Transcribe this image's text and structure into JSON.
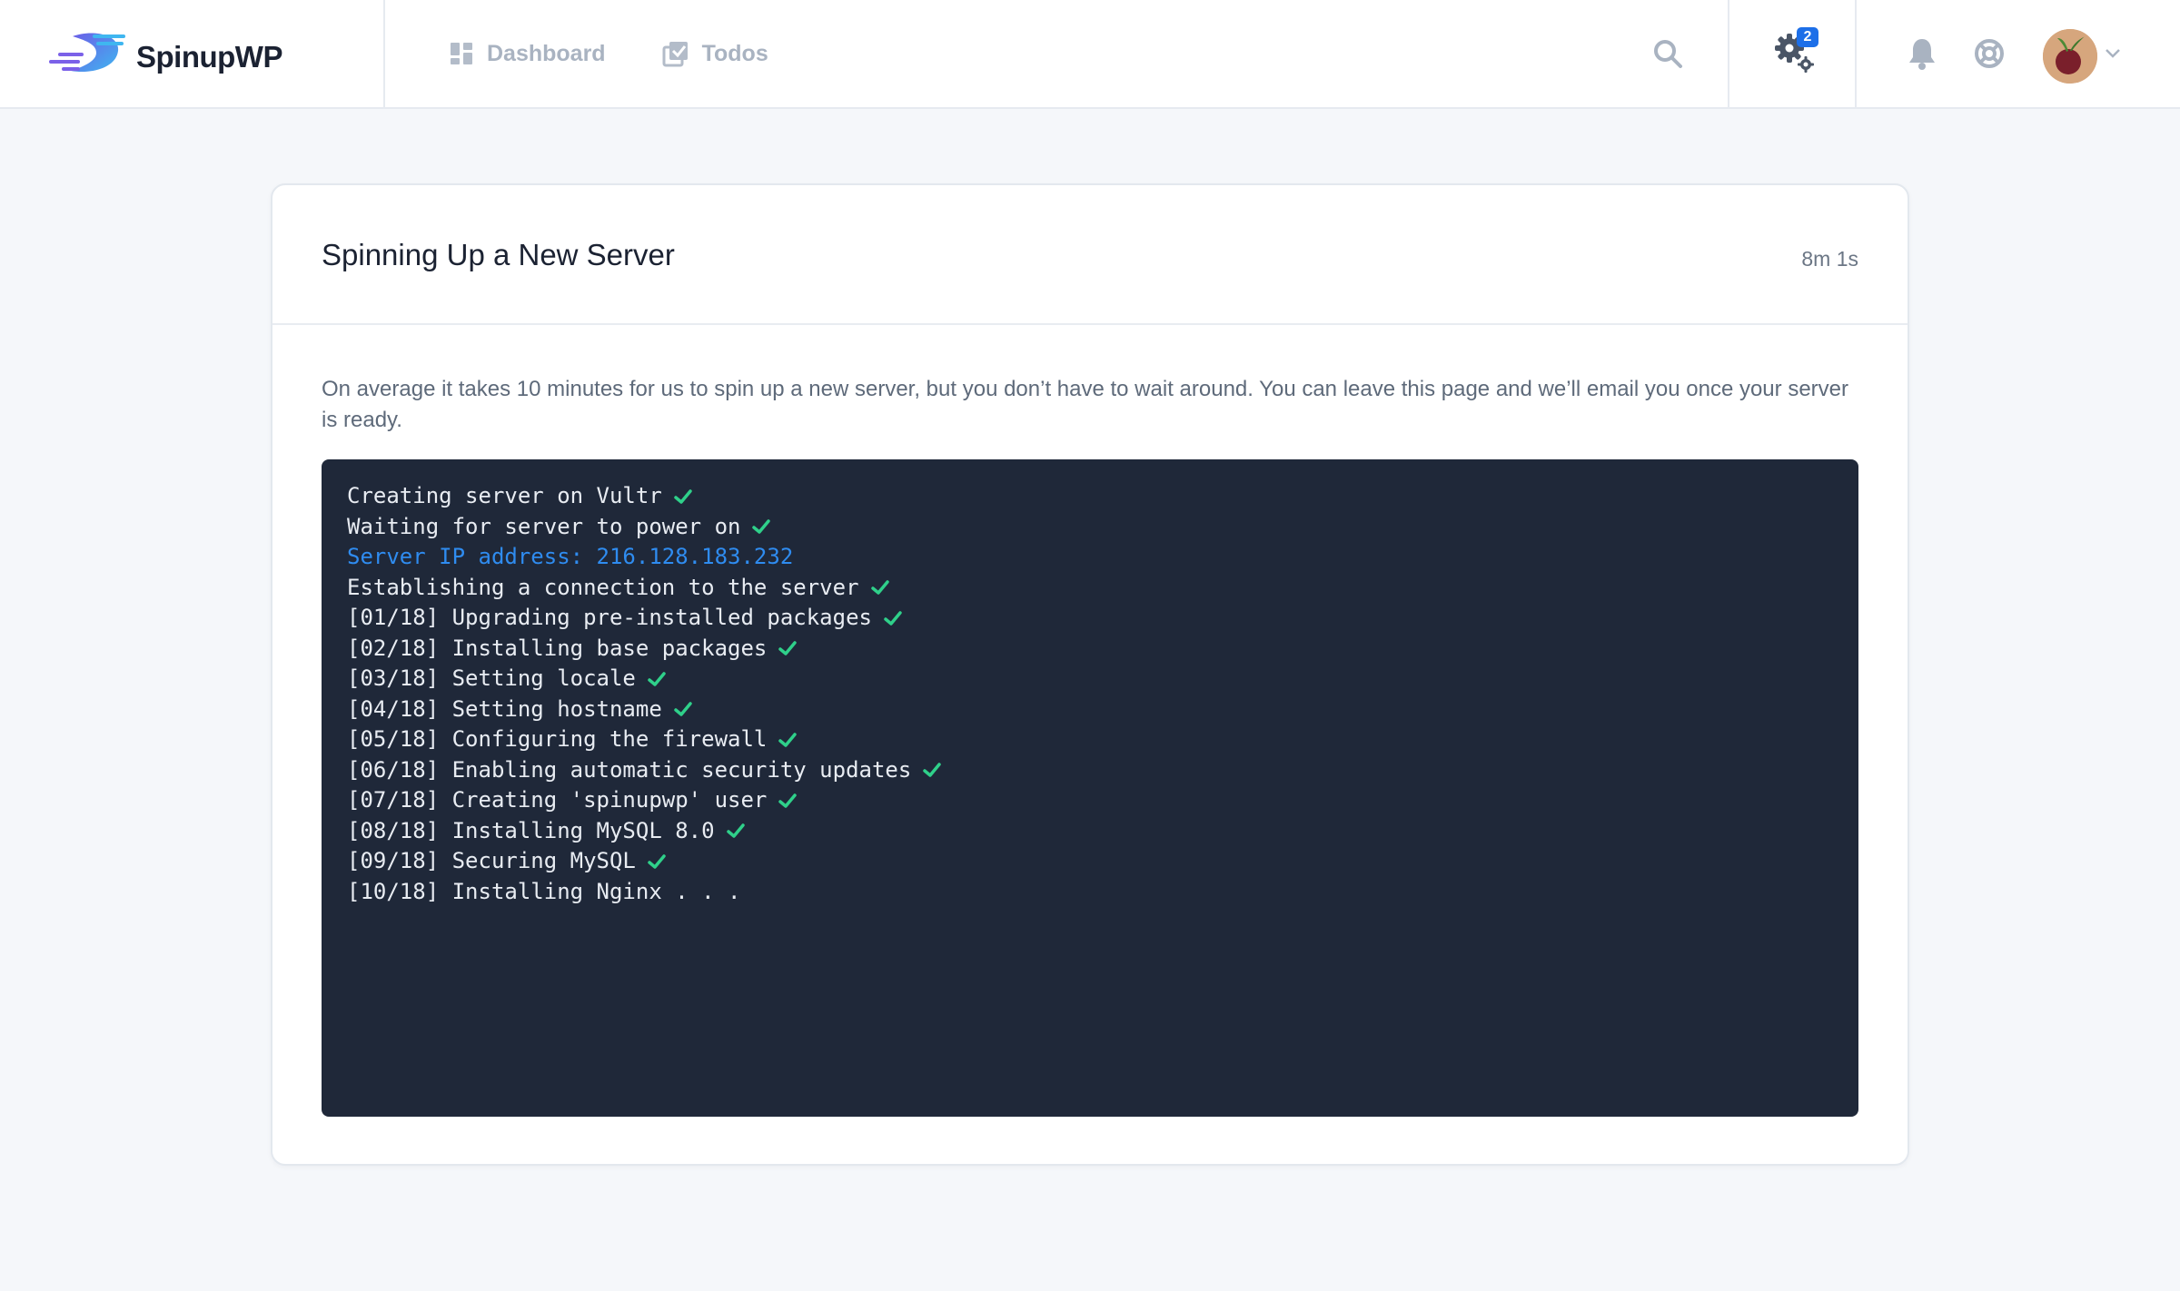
{
  "brand": {
    "name": "SpinupWP"
  },
  "nav": [
    {
      "label": "Dashboard",
      "icon": "dashboard-icon"
    },
    {
      "label": "Todos",
      "icon": "todos-icon"
    }
  ],
  "header": {
    "settings_badge": "2",
    "icons": [
      "search-icon",
      "gear-icon",
      "bell-icon",
      "help-icon",
      "chevron-down-icon"
    ]
  },
  "card": {
    "title": "Spinning Up a New Server",
    "timer": "8m 1s",
    "description": "On average it takes 10 minutes for us to spin up a new server, but you don’t have to wait around. You can leave this page and we’ll email you once your server is ready."
  },
  "terminal": {
    "lines": [
      {
        "text": "Creating server on Vultr",
        "done": true
      },
      {
        "text": "Waiting for server to power on",
        "done": true
      },
      {
        "text": "Server IP address: 216.128.183.232",
        "info": true
      },
      {
        "text": "Establishing a connection to the server",
        "done": true
      },
      {
        "text": "[01/18] Upgrading pre-installed packages",
        "done": true
      },
      {
        "text": "[02/18] Installing base packages",
        "done": true
      },
      {
        "text": "[03/18] Setting locale",
        "done": true
      },
      {
        "text": "[04/18] Setting hostname",
        "done": true
      },
      {
        "text": "[05/18] Configuring the firewall",
        "done": true
      },
      {
        "text": "[06/18] Enabling automatic security updates",
        "done": true
      },
      {
        "text": "[07/18] Creating 'spinupwp' user",
        "done": true
      },
      {
        "text": "[08/18] Installing MySQL 8.0",
        "done": true
      },
      {
        "text": "[09/18] Securing MySQL",
        "done": true
      },
      {
        "text": "[10/18] Installing Nginx . . .",
        "done": false
      }
    ]
  },
  "colors": {
    "accent": "#1d6fe8",
    "terminal_bg": "#1f2839",
    "check": "#2fd08a",
    "info": "#2f8cf0"
  }
}
